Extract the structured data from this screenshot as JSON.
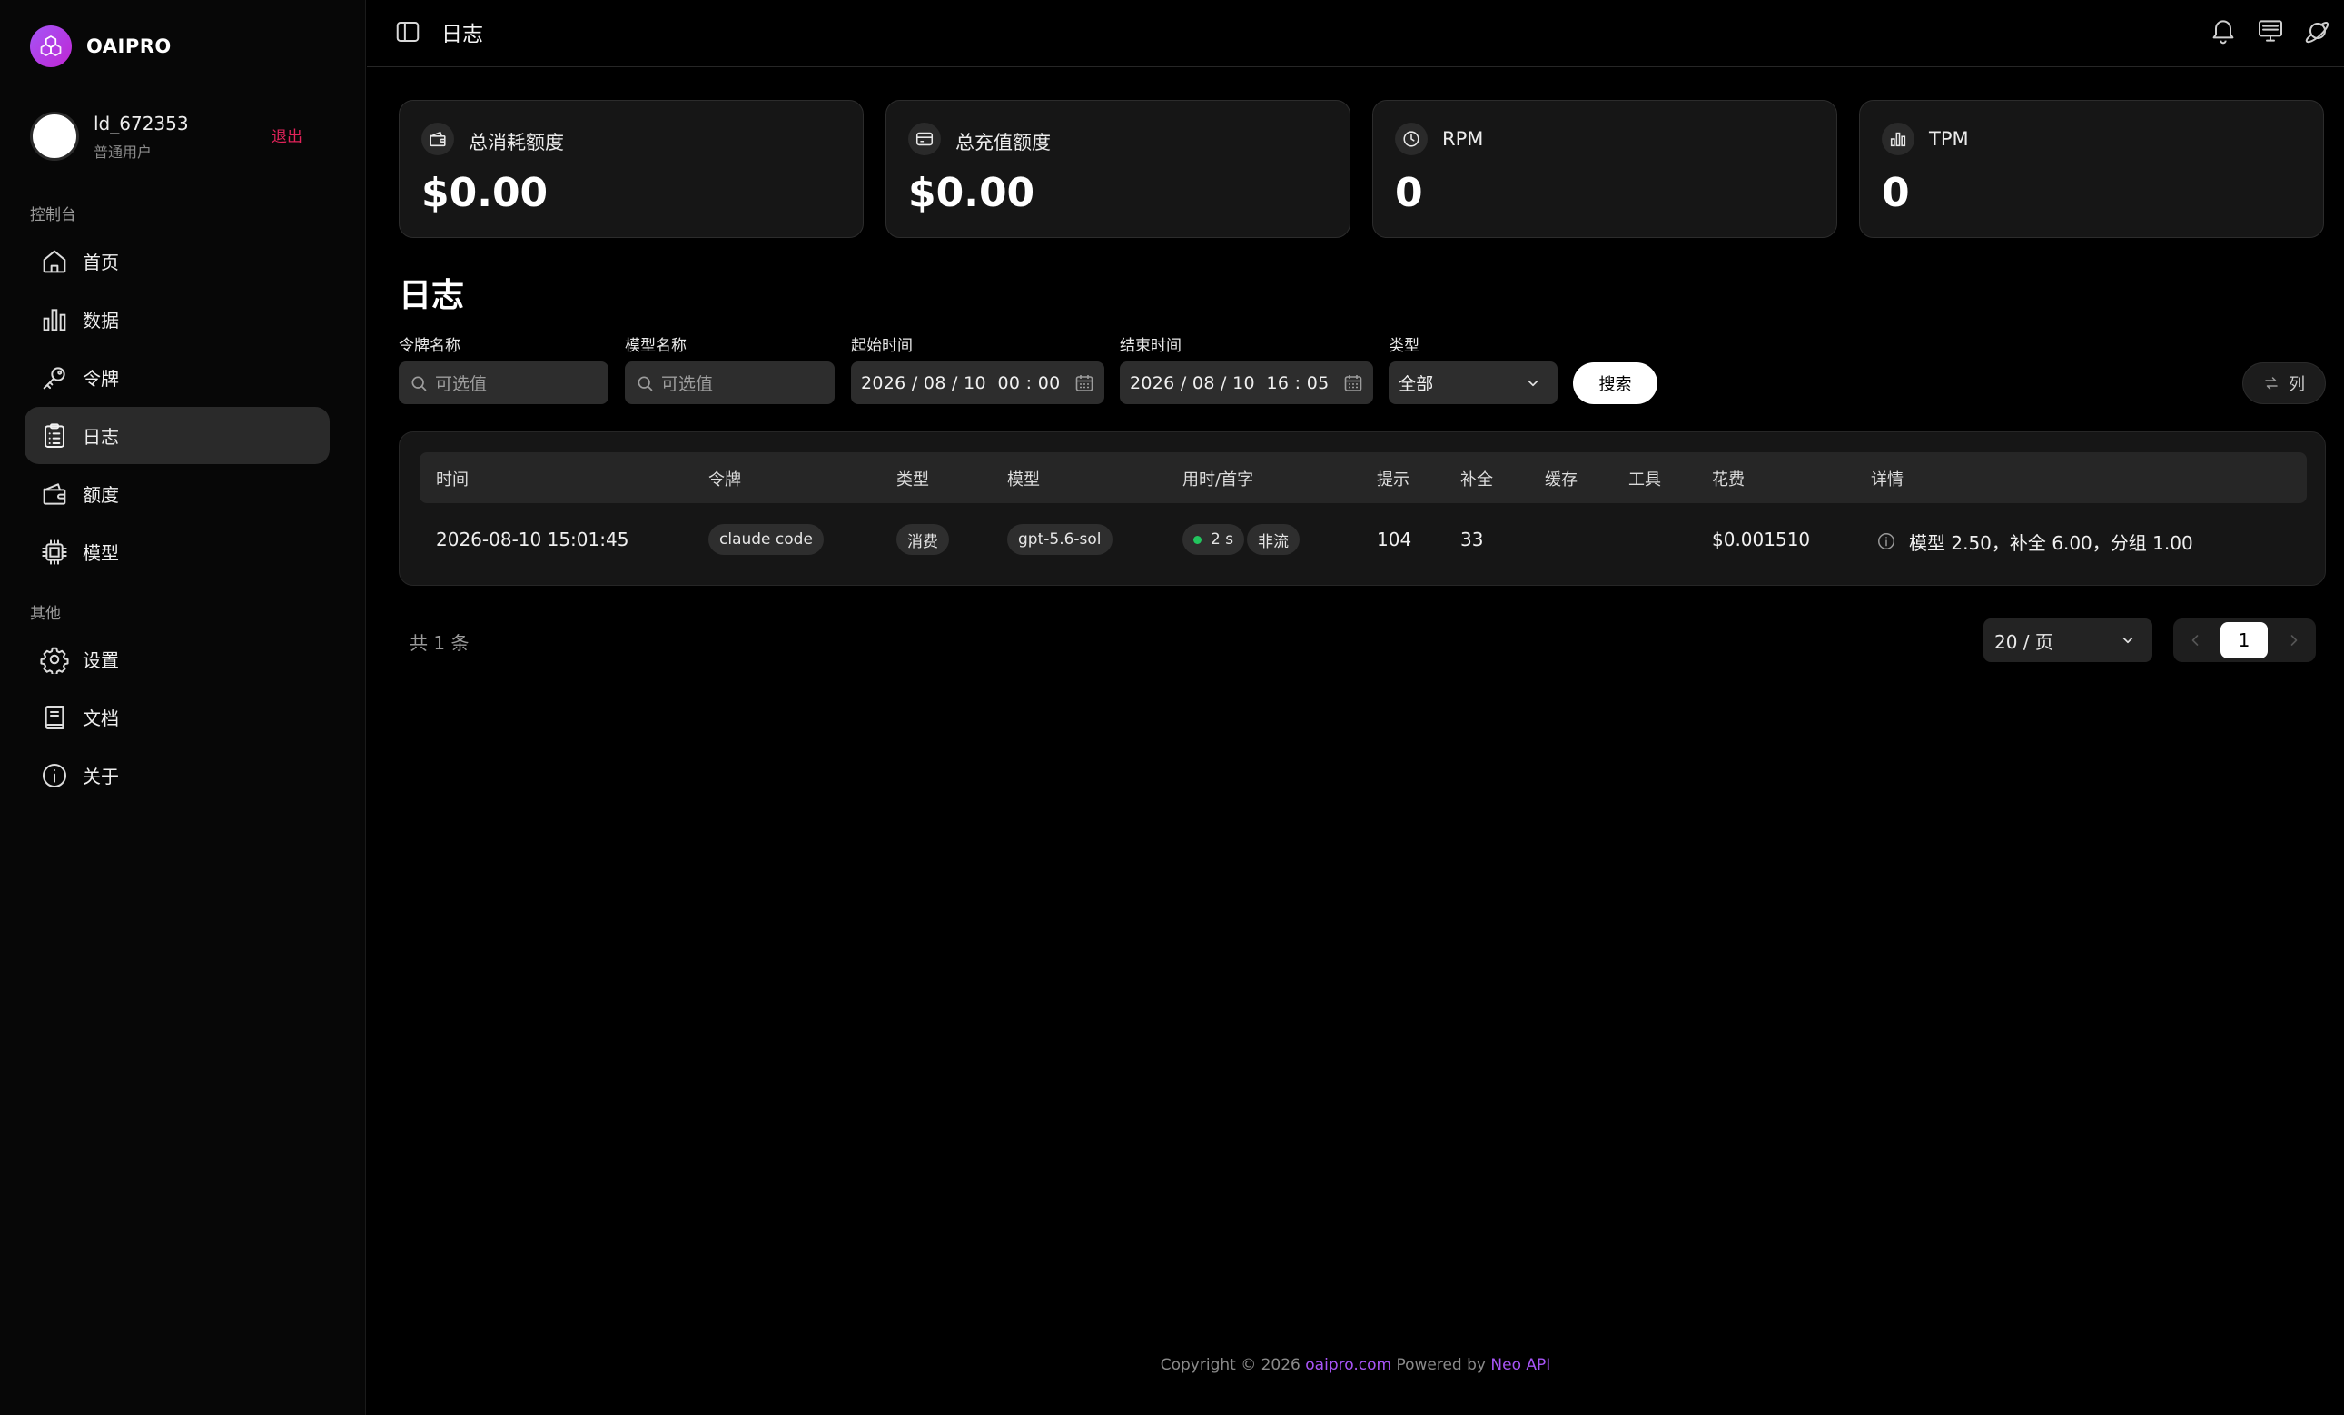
{
  "brand": {
    "name": "OAIPRO"
  },
  "user": {
    "name": "ld_672353",
    "role": "普通用户",
    "logout": "退出"
  },
  "sidebar": {
    "section_console": "控制台",
    "section_other": "其他",
    "items": [
      {
        "label": "首页",
        "icon": "home-icon"
      },
      {
        "label": "数据",
        "icon": "bar-chart-icon"
      },
      {
        "label": "令牌",
        "icon": "key-icon"
      },
      {
        "label": "日志",
        "icon": "clipboard-list-icon",
        "active": true
      },
      {
        "label": "额度",
        "icon": "wallet-icon"
      },
      {
        "label": "模型",
        "icon": "cpu-icon"
      },
      {
        "label": "设置",
        "icon": "gear-icon"
      },
      {
        "label": "文档",
        "icon": "book-icon"
      },
      {
        "label": "关于",
        "icon": "info-icon"
      }
    ]
  },
  "header": {
    "title": "日志"
  },
  "stats": [
    {
      "label": "总消耗额度",
      "value": "$0.00",
      "icon": "wallet-icon"
    },
    {
      "label": "总充值额度",
      "value": "$0.00",
      "icon": "credit-card-icon"
    },
    {
      "label": "RPM",
      "value": "0",
      "icon": "clock-icon"
    },
    {
      "label": "TPM",
      "value": "0",
      "icon": "bar-chart-icon"
    }
  ],
  "page": {
    "heading": "日志"
  },
  "filters": {
    "token": {
      "label": "令牌名称",
      "placeholder": "可选值"
    },
    "model": {
      "label": "模型名称",
      "placeholder": "可选值"
    },
    "start": {
      "label": "起始时间",
      "value": "2026 / 08 / 10  00 : 00"
    },
    "end": {
      "label": "结束时间",
      "value": "2026 / 08 / 10  16 : 05"
    },
    "type": {
      "label": "类型",
      "value": "全部"
    },
    "search_button": "搜索",
    "columns_button": "列"
  },
  "table": {
    "headers": [
      "时间",
      "令牌",
      "类型",
      "模型",
      "用时/首字",
      "提示",
      "补全",
      "缓存",
      "工具",
      "花费",
      "详情"
    ],
    "rows": [
      {
        "time": "2026-08-10 15:01:45",
        "token": "claude code",
        "type": "消费",
        "model": "gpt-5.6-sol",
        "duration": "2 s",
        "stream": "非流",
        "prompt": "104",
        "completion": "33",
        "cache": "",
        "tools": "",
        "cost": "$0.001510",
        "detail": "模型 2.50，补全 6.00，分组 1.00"
      }
    ]
  },
  "pagination": {
    "total": "共 1 条",
    "page_size": "20 / 页",
    "current": "1"
  },
  "footer": {
    "prefix": "Copyright © 2026 ",
    "site": "oaipro.com",
    "middle": " Powered by ",
    "powered": "Neo API"
  },
  "colors": {
    "accent": "#a855f7",
    "logout": "#e2235a",
    "success": "#22c55e"
  }
}
